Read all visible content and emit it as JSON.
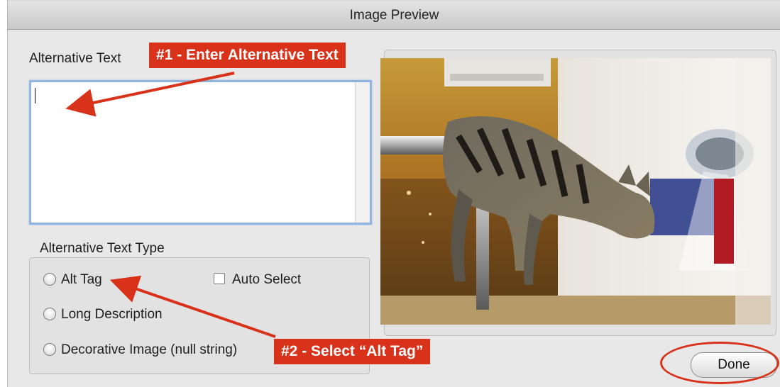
{
  "window": {
    "title": "Image Preview"
  },
  "alt_text": {
    "label": "Alternative Text",
    "value": ""
  },
  "alt_type": {
    "label": "Alternative Text Type",
    "options": [
      "Alt Tag",
      "Long Description",
      "Decorative Image (null string)"
    ],
    "auto_select_label": "Auto Select"
  },
  "annotations": {
    "step1": "#1 - Enter Alternative Text",
    "step2": "#2 - Select “Alt Tag”",
    "color": "#d8321a"
  },
  "buttons": {
    "done": "Done"
  },
  "preview": {
    "subject": "cat-on-railing-photo"
  }
}
